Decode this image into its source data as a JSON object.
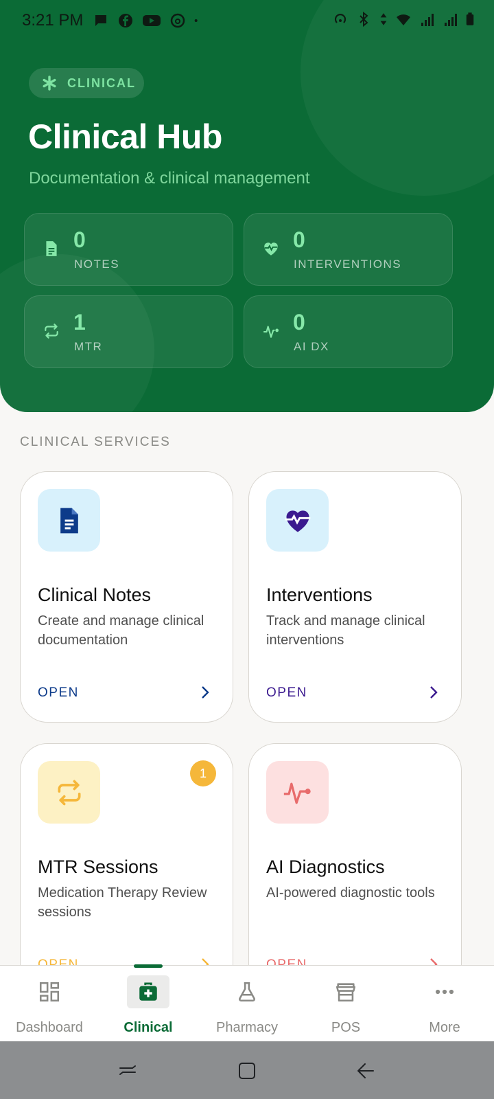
{
  "status_bar": {
    "time": "3:21 PM",
    "left_icons": [
      "chat-bubble-icon",
      "facebook-icon",
      "youtube-icon",
      "threads-icon",
      "more-dot-icon"
    ],
    "right_icons": [
      "hotspot-icon",
      "bluetooth-icon",
      "data-transfer-icon",
      "wifi-icon",
      "signal-4g-icon",
      "signal-3g-icon",
      "battery-icon"
    ]
  },
  "header": {
    "badge": "CLINICAL",
    "badge_icon": "asterisk-icon",
    "title": "Clinical Hub",
    "subtitle": "Documentation & clinical management",
    "colors": {
      "background": "#0b6b36",
      "accent": "#86e8a9"
    }
  },
  "stats": [
    {
      "value": "0",
      "label": "NOTES",
      "icon": "document-icon"
    },
    {
      "value": "0",
      "label": "INTERVENTIONS",
      "icon": "heart-pulse-icon"
    },
    {
      "value": "1",
      "label": "MTR",
      "icon": "repeat-icon"
    },
    {
      "value": "0",
      "label": "AI DX",
      "icon": "activity-icon"
    }
  ],
  "services": {
    "section_title": "CLINICAL SERVICES",
    "cards": [
      {
        "title": "Clinical Notes",
        "description": "Create and manage clinical documentation",
        "action": "OPEN",
        "icon": "document-icon",
        "icon_bg": "#d8f1fc",
        "accent": "#0d3b8a"
      },
      {
        "title": "Interventions",
        "description": "Track and manage clinical interventions",
        "action": "OPEN",
        "icon": "heart-pulse-icon",
        "icon_bg": "#d8f1fc",
        "accent": "#3b1a8f"
      },
      {
        "title": "MTR Sessions",
        "description": "Medication Therapy Review sessions",
        "action": "OPEN",
        "icon": "repeat-icon",
        "icon_bg": "#fdf1c4",
        "accent": "#f5b73a",
        "badge": "1"
      },
      {
        "title": "AI Diagnostics",
        "description": "AI-powered diagnostic tools",
        "action": "OPEN",
        "icon": "activity-icon",
        "icon_bg": "#fde0e0",
        "accent": "#e86b6b"
      }
    ]
  },
  "bottom_nav": {
    "items": [
      {
        "label": "Dashboard",
        "icon": "dashboard-icon"
      },
      {
        "label": "Clinical",
        "icon": "medical-bag-icon",
        "active": true
      },
      {
        "label": "Pharmacy",
        "icon": "flask-icon"
      },
      {
        "label": "POS",
        "icon": "store-icon"
      },
      {
        "label": "More",
        "icon": "more-horizontal-icon"
      }
    ]
  },
  "system_nav": [
    "recents-icon",
    "home-icon",
    "back-icon"
  ]
}
